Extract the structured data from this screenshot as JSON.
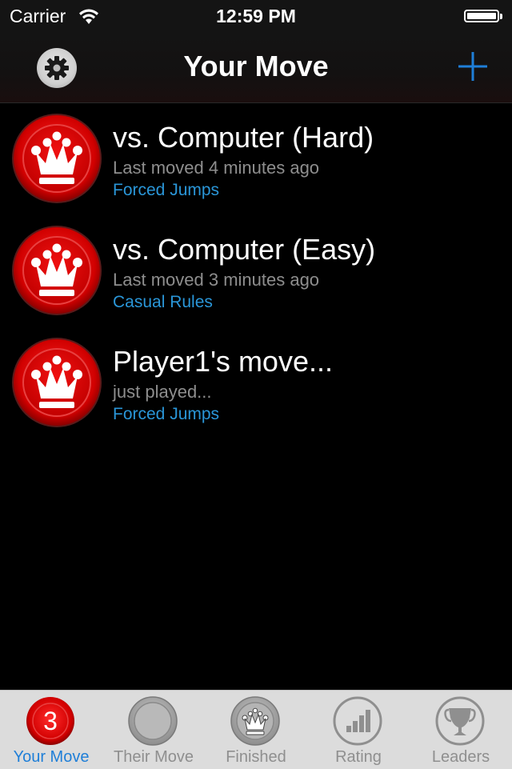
{
  "status_bar": {
    "carrier": "Carrier",
    "time": "12:59 PM",
    "wifi_icon": "wifi-icon",
    "battery_icon": "battery-full-icon"
  },
  "nav": {
    "title": "Your Move",
    "left_button_icon": "gear-icon",
    "right_button_icon": "plus-icon",
    "accent_color": "#1f7fd8"
  },
  "games": [
    {
      "title": "vs. Computer (Hard)",
      "subtitle": "Last moved 4 minutes ago",
      "rules": "Forced Jumps",
      "icon": "red-king-checker-icon"
    },
    {
      "title": "vs. Computer (Easy)",
      "subtitle": "Last moved 3 minutes ago",
      "rules": "Casual Rules",
      "icon": "red-king-checker-icon"
    },
    {
      "title": "Player1's move...",
      "subtitle": "just played...",
      "rules": "Forced Jumps",
      "icon": "red-king-checker-icon"
    }
  ],
  "tabs": [
    {
      "label": "Your Move",
      "badge": "3",
      "icon": "red-checker-badge-icon",
      "active": true
    },
    {
      "label": "Their Move",
      "icon": "gray-checker-icon",
      "active": false
    },
    {
      "label": "Finished",
      "icon": "gray-king-checker-icon",
      "active": false
    },
    {
      "label": "Rating",
      "icon": "bar-chart-icon",
      "active": false
    },
    {
      "label": "Leaders",
      "icon": "trophy-icon",
      "active": false
    }
  ],
  "colors": {
    "rules_text": "#2a96d8",
    "subtitle_text": "#8e8e8e",
    "checker_red": "#d40000"
  }
}
